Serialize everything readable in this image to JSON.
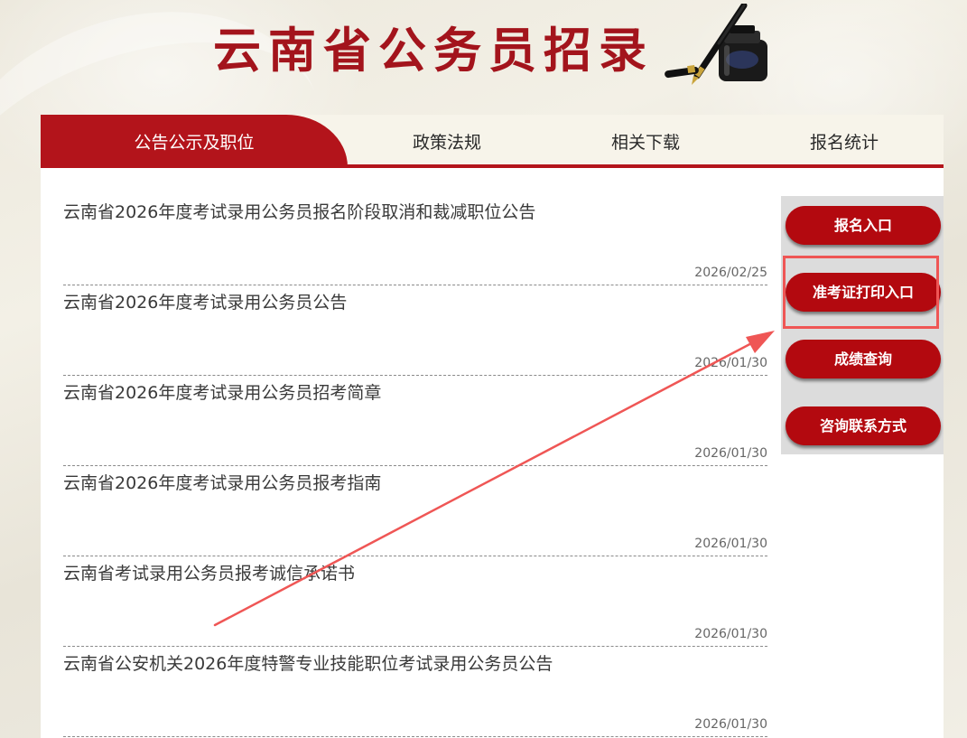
{
  "header": {
    "title": "云南省公务员招录",
    "logo_icon": "fountain-pen-and-ink-bottle-icon"
  },
  "colors": {
    "brand_red": "#b3141b",
    "button_red": "#b3090f",
    "annotation_red": "#ef5655"
  },
  "tabs": [
    {
      "label": "公告公示及职位",
      "active": true
    },
    {
      "label": "政策法规",
      "active": false
    },
    {
      "label": "相关下载",
      "active": false
    },
    {
      "label": "报名统计",
      "active": false
    }
  ],
  "news": [
    {
      "title": "云南省2026年度考试录用公务员报名阶段取消和裁减职位公告",
      "date": "2026/02/25"
    },
    {
      "title": "云南省2026年度考试录用公务员公告",
      "date": "2026/01/30"
    },
    {
      "title": "云南省2026年度考试录用公务员招考简章",
      "date": "2026/01/30"
    },
    {
      "title": "云南省2026年度考试录用公务员报考指南",
      "date": "2026/01/30"
    },
    {
      "title": "云南省考试录用公务员报考诚信承诺书",
      "date": "2026/01/30"
    },
    {
      "title": "云南省公安机关2026年度特警专业技能职位考试录用公务员公告",
      "date": "2026/01/30"
    }
  ],
  "side_buttons": [
    {
      "label": "报名入口"
    },
    {
      "label": "准考证打印入口",
      "highlighted": true
    },
    {
      "label": "成绩查询"
    },
    {
      "label": "咨询联系方式"
    }
  ]
}
